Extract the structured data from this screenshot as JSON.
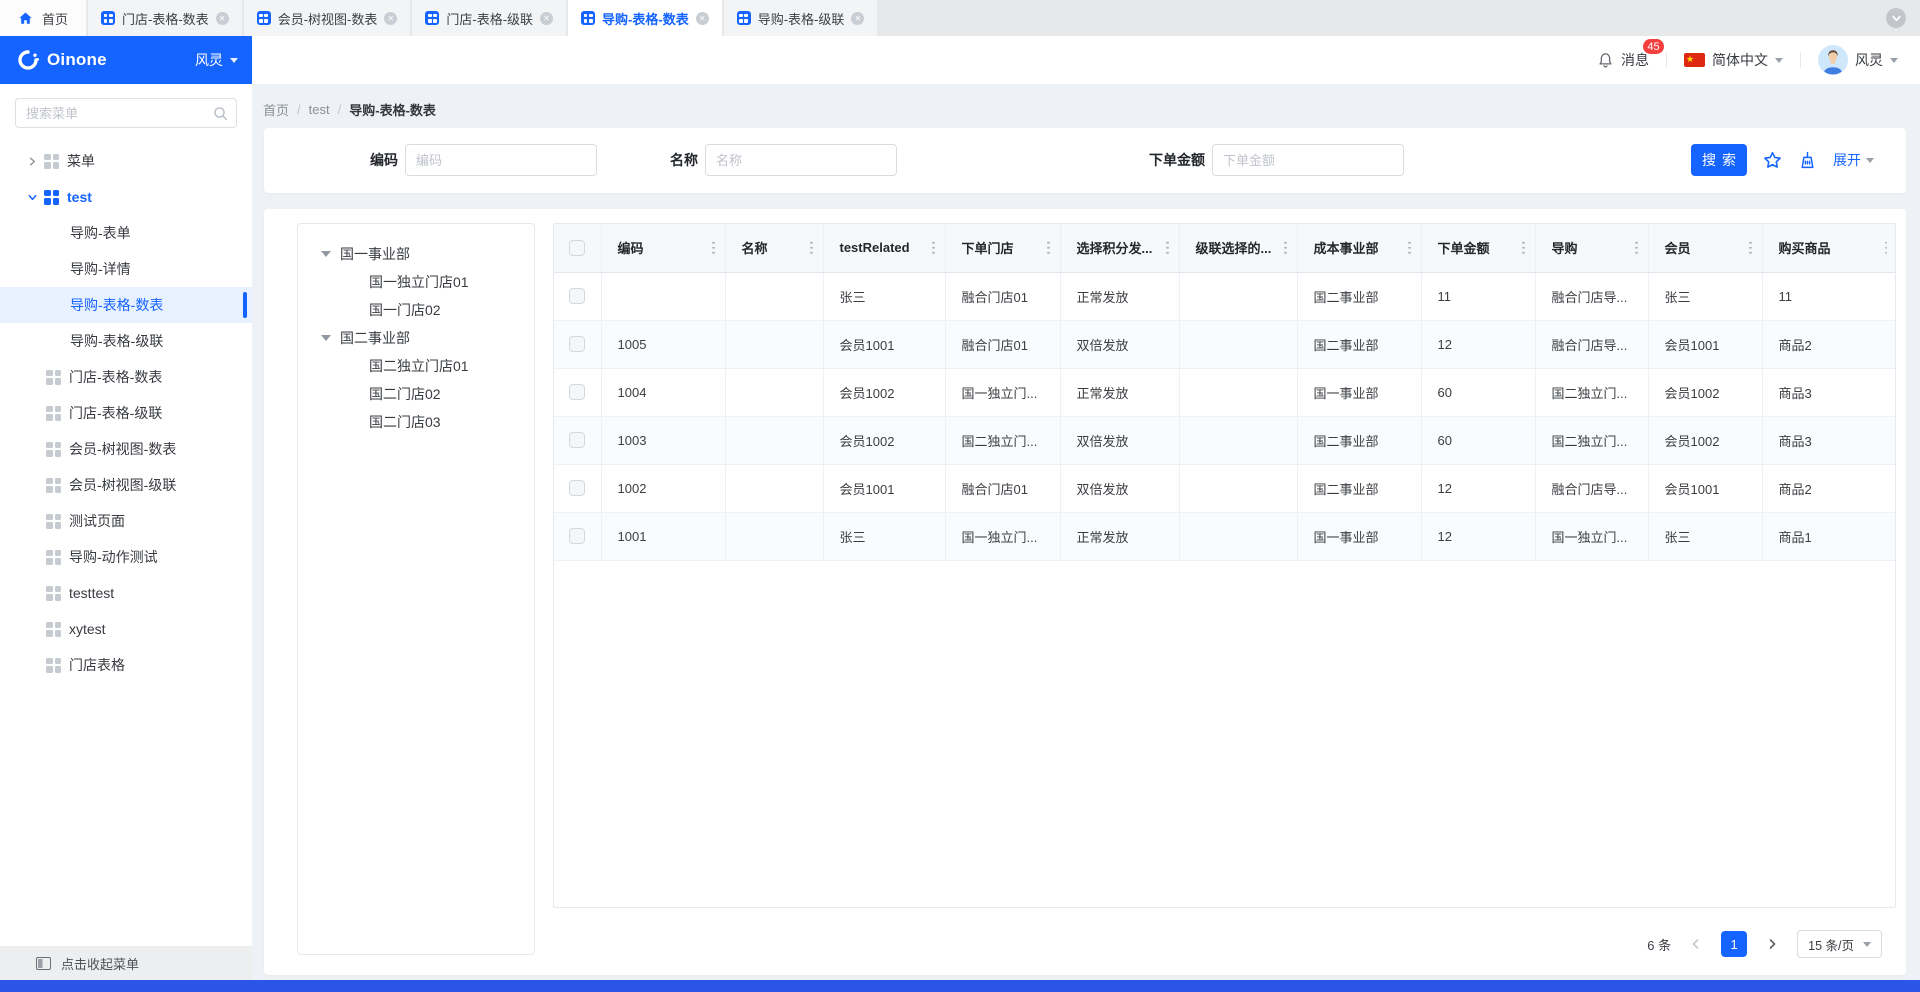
{
  "tabbar": {
    "home_label": "首页",
    "tabs": [
      {
        "label": "门店-表格-数表",
        "active": false
      },
      {
        "label": "会员-树视图-数表",
        "active": false
      },
      {
        "label": "门店-表格-级联",
        "active": false
      },
      {
        "label": "导购-表格-数表",
        "active": true
      },
      {
        "label": "导购-表格-级联",
        "active": false
      }
    ]
  },
  "header": {
    "logo": "Oinone",
    "env": "风灵",
    "message": "消息",
    "badge": "45",
    "lang": "简体中文",
    "user": "风灵"
  },
  "sidebar": {
    "search_placeholder": "搜索菜单",
    "collapse_label": "点击收起菜单",
    "items": [
      {
        "label": "菜单",
        "kind": "group",
        "expanded": false,
        "active": false,
        "selected": false
      },
      {
        "label": "test",
        "kind": "group",
        "expanded": true,
        "active": true,
        "selected": false
      },
      {
        "label": "导购-表单",
        "kind": "child",
        "selected": false
      },
      {
        "label": "导购-详情",
        "kind": "child",
        "selected": false
      },
      {
        "label": "导购-表格-数表",
        "kind": "child",
        "selected": true
      },
      {
        "label": "导购-表格-级联",
        "kind": "child",
        "selected": false
      },
      {
        "label": "门店-表格-数表",
        "kind": "leaf",
        "selected": false
      },
      {
        "label": "门店-表格-级联",
        "kind": "leaf",
        "selected": false
      },
      {
        "label": "会员-树视图-数表",
        "kind": "leaf",
        "selected": false
      },
      {
        "label": "会员-树视图-级联",
        "kind": "leaf",
        "selected": false
      },
      {
        "label": "测试页面",
        "kind": "leaf",
        "selected": false
      },
      {
        "label": "导购-动作测试",
        "kind": "leaf",
        "selected": false
      },
      {
        "label": "testtest",
        "kind": "leaf",
        "selected": false
      },
      {
        "label": "xytest",
        "kind": "leaf",
        "selected": false
      },
      {
        "label": "门店表格",
        "kind": "leaf",
        "selected": false
      }
    ]
  },
  "breadcrumb": {
    "items": [
      "首页",
      "test",
      "导购-表格-数表"
    ]
  },
  "filters": {
    "search_label": "搜索",
    "expand_label": "展开",
    "fields": [
      {
        "label": "编码",
        "placeholder": "编码"
      },
      {
        "label": "名称",
        "placeholder": "名称"
      },
      {
        "label": "下单金额",
        "placeholder": "下单金额"
      }
    ]
  },
  "tree": {
    "nodes": [
      {
        "label": "国一事业部",
        "children": [
          "国一独立门店01",
          "国一门店02"
        ]
      },
      {
        "label": "国二事业部",
        "children": [
          "国二独立门店01",
          "国二门店02",
          "国二门店03"
        ]
      }
    ]
  },
  "table": {
    "columns": [
      "编码",
      "名称",
      "testRelated",
      "下单门店",
      "选择积分发...",
      "级联选择的...",
      "成本事业部",
      "下单金额",
      "导购",
      "会员",
      "购买商品"
    ],
    "rows": [
      [
        "",
        "",
        "张三",
        "融合门店01",
        "正常发放",
        "",
        "国二事业部",
        "11",
        "融合门店导...",
        "张三",
        "11"
      ],
      [
        "1005",
        "",
        "会员1001",
        "融合门店01",
        "双倍发放",
        "",
        "国二事业部",
        "12",
        "融合门店导...",
        "会员1001",
        "商品2"
      ],
      [
        "1004",
        "",
        "会员1002",
        "国一独立门...",
        "正常发放",
        "",
        "国一事业部",
        "60",
        "国二独立门...",
        "会员1002",
        "商品3"
      ],
      [
        "1003",
        "",
        "会员1002",
        "国二独立门...",
        "双倍发放",
        "",
        "国二事业部",
        "60",
        "国二独立门...",
        "会员1002",
        "商品3"
      ],
      [
        "1002",
        "",
        "会员1001",
        "融合门店01",
        "双倍发放",
        "",
        "国二事业部",
        "12",
        "融合门店导...",
        "会员1001",
        "商品2"
      ],
      [
        "1001",
        "",
        "张三",
        "国一独立门...",
        "正常发放",
        "",
        "国一事业部",
        "12",
        "国一独立门...",
        "张三",
        "商品1"
      ]
    ]
  },
  "pagination": {
    "total": "6 条",
    "page": "1",
    "size": "15 条/页"
  },
  "colors": {
    "primary": "#1664FF",
    "badge_red": "#F53F3F",
    "flag_red": "#DE2910",
    "bottom_bar": "#2B55E6"
  }
}
